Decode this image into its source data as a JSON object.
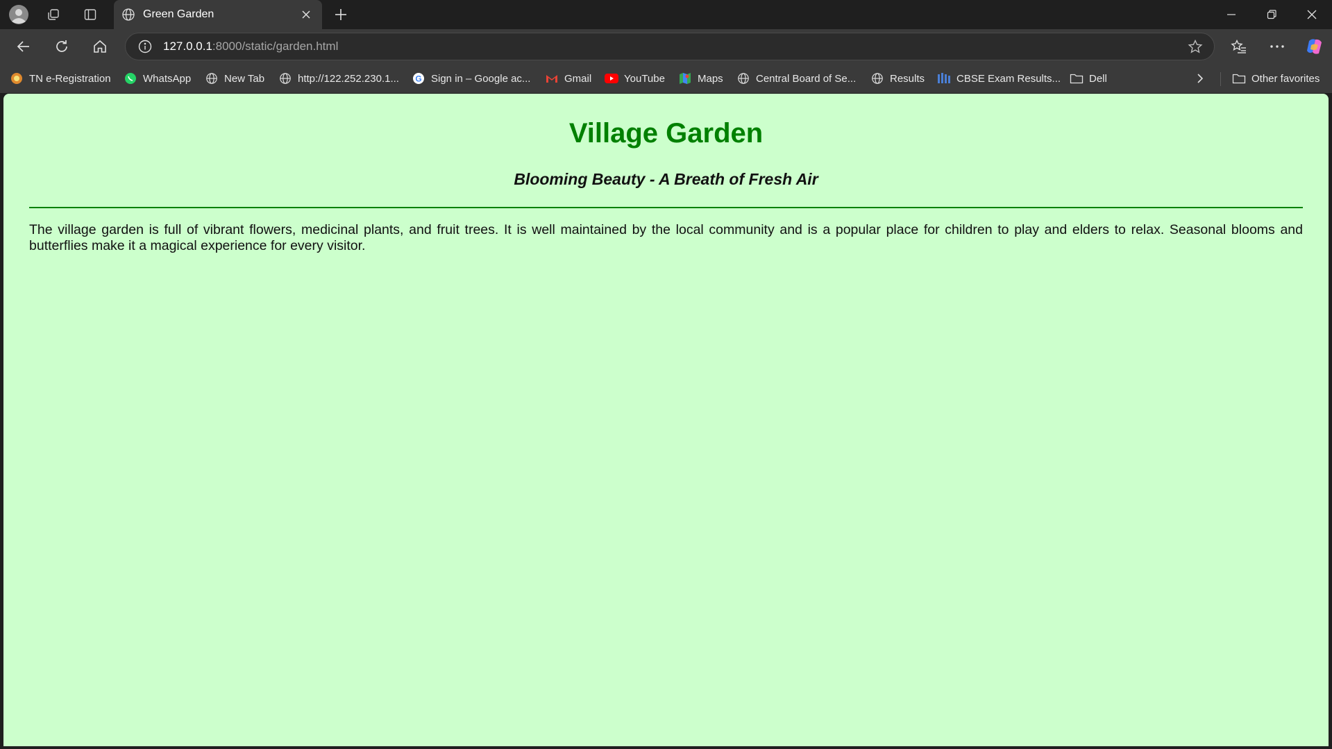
{
  "tab": {
    "title": "Green Garden"
  },
  "address": {
    "host": "127.0.0.1",
    "path": ":8000/static/garden.html"
  },
  "bookmarks": [
    {
      "label": "TN e-Registration",
      "icon": "tn-registration-icon"
    },
    {
      "label": "WhatsApp",
      "icon": "whatsapp-icon"
    },
    {
      "label": "New Tab",
      "icon": "globe-icon"
    },
    {
      "label": "http://122.252.230.1...",
      "icon": "globe-icon"
    },
    {
      "label": "Sign in – Google ac...",
      "icon": "google-icon"
    },
    {
      "label": "Gmail",
      "icon": "gmail-icon"
    },
    {
      "label": "YouTube",
      "icon": "youtube-icon"
    },
    {
      "label": "Maps",
      "icon": "maps-icon"
    },
    {
      "label": "Central Board of Se...",
      "icon": "globe-icon"
    },
    {
      "label": "Results",
      "icon": "globe-icon"
    },
    {
      "label": "CBSE Exam Results...",
      "icon": "cbse-icon"
    },
    {
      "label": "Dell",
      "icon": "folder-icon"
    }
  ],
  "other_favorites": {
    "label": "Other favorites"
  },
  "page": {
    "heading": "Village Garden",
    "subheading": "Blooming Beauty - A Breath of Fresh Air",
    "paragraph": "The village garden is full of vibrant flowers, medicinal plants, and fruit trees. It is well maintained by the local community and is a popular place for children to play and elders to relax. Seasonal blooms and butterflies make it a magical experience for every visitor."
  },
  "colors": {
    "page_background": "#ccffcc",
    "heading": "#008000",
    "divider": "#008000",
    "browser_chrome": "#3a3a3a"
  }
}
